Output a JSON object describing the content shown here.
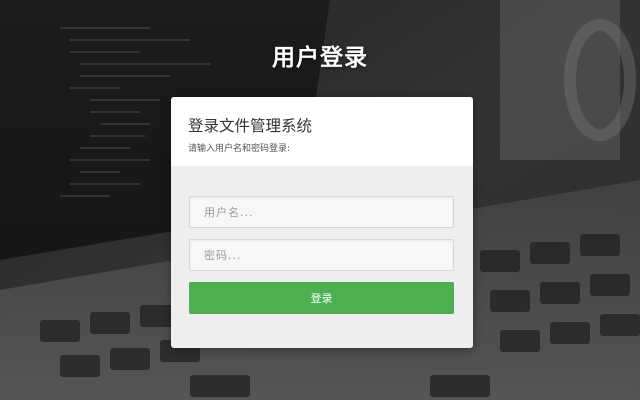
{
  "page": {
    "title": "用户登录"
  },
  "login_card": {
    "title": "登录文件管理系统",
    "subtitle": "请输入用户名和密码登录:",
    "username": {
      "value": "",
      "placeholder": "用户名..."
    },
    "password": {
      "value": "",
      "placeholder": "密码..."
    },
    "submit_label": "登录"
  },
  "colors": {
    "primary_button": "#4caf50",
    "card_header": "#ffffff",
    "card_body": "#eeeeee",
    "background": "#3a3a3a"
  }
}
